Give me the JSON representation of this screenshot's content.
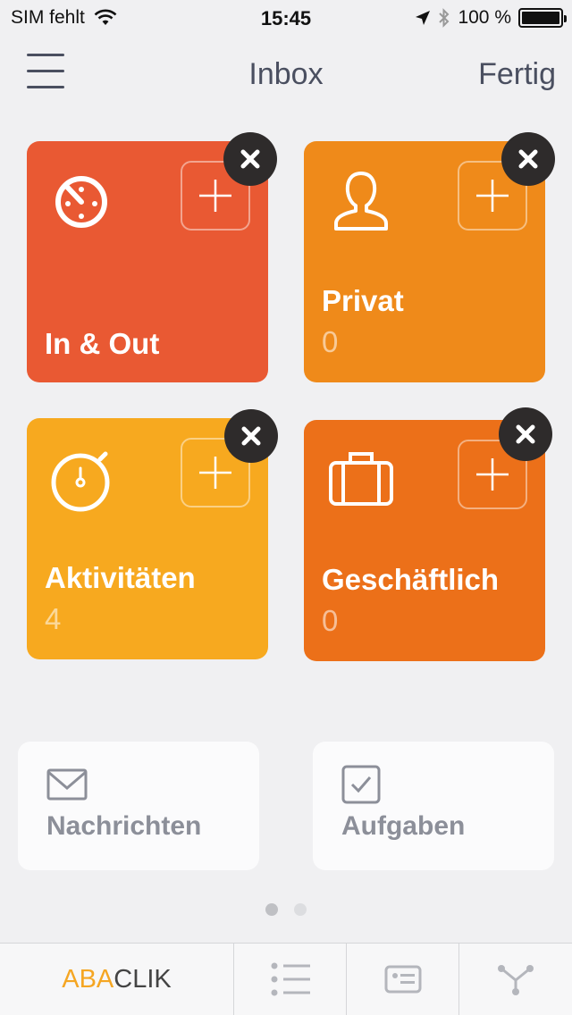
{
  "status": {
    "carrier": "SIM fehlt",
    "time": "15:45",
    "battery": "100 %"
  },
  "nav": {
    "title": "Inbox",
    "done": "Fertig"
  },
  "tiles": [
    {
      "label": "In & Out",
      "count": "",
      "color": "#e95933",
      "icon": "time-tracker-icon"
    },
    {
      "label": "Privat",
      "count": "0",
      "color": "#ef8a1a",
      "icon": "person-icon"
    },
    {
      "label": "Aktivitäten",
      "count": "4",
      "color": "#f7a91f",
      "icon": "stopwatch-icon"
    },
    {
      "label": "Geschäftlich",
      "count": "0",
      "color": "#ec7019",
      "icon": "briefcase-icon"
    }
  ],
  "cards": [
    {
      "label": "Nachrichten",
      "icon": "envelope-icon"
    },
    {
      "label": "Aufgaben",
      "icon": "checkbox-icon"
    }
  ],
  "pager": {
    "pages": 2,
    "active": 1
  },
  "tabbar": {
    "brand_a": "ABA",
    "brand_b": "CLIK",
    "icons": [
      "list-icon",
      "contact-card-icon",
      "network-icon"
    ]
  }
}
